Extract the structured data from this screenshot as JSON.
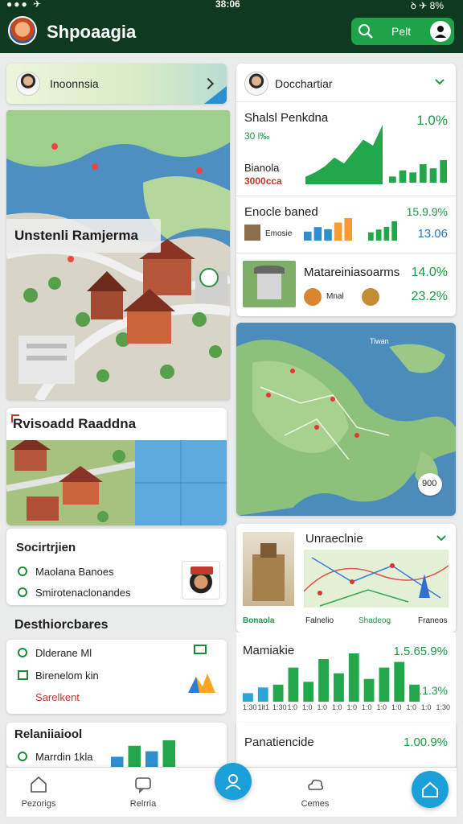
{
  "status_bar": {
    "time": "38:06",
    "signal": "●●● ✈",
    "battery": "ꝺ ✈ 8%"
  },
  "app": {
    "title": "Shpoaagia"
  },
  "header": {
    "search_label": "Pelt"
  },
  "colors": {
    "brand_dark": "#0f3a1f",
    "accent_green": "#1fa34a",
    "fab_blue": "#1b9fd8"
  },
  "left": {
    "region_card": {
      "title": "Inoonnsia"
    },
    "map_overlay_label": "Unstenli Ramjerma",
    "heritage_title": "Rvisoadd Raaddna",
    "social": {
      "title": "Socirtrjien",
      "items": [
        "Maolana Banoes",
        "Smirotenaclonandes"
      ]
    },
    "destinations": {
      "heading": "Desthiorcbares",
      "items": [
        "Dlderane Ml",
        "Birenelom kin",
        "Sarelkent"
      ]
    },
    "relations": {
      "heading": "Relaniiaiool",
      "items": [
        "Marrdin 1kla"
      ]
    }
  },
  "right": {
    "kpi_header": {
      "title": "Docchartiar"
    },
    "kpi_rows": [
      {
        "title": "Shalsl Penkdna",
        "subtitle": "30 l‰",
        "sub2": "Bianola",
        "sub3": "3000cca",
        "value": "1.0%"
      },
      {
        "title": "Enocle baned",
        "sub": "Emosie",
        "value1": "15.9.9%",
        "value2": "13.06"
      },
      {
        "title": "Matareiniasoarms",
        "sub": "Mnal",
        "value1": "14.0%",
        "value2": "23.2%"
      }
    ],
    "map_badge": "900",
    "map_label": "Tiwan",
    "route_card": {
      "title": "Unraeclnie",
      "tabs": [
        "Bonaola",
        "Falnelio",
        "Shadeog",
        "Franeos"
      ]
    },
    "stats": {
      "title": "Mamiakie",
      "value1": "1.5.65.9%",
      "value2": "1.1.3%",
      "tick_labels": [
        "1:30",
        "1lt1",
        "1:30",
        "1:0",
        "1:0",
        "1:0",
        "1:0",
        "1:0",
        "1:0",
        "1:0",
        "1:0",
        "1:0",
        "1:0",
        "1:30"
      ]
    },
    "performance": {
      "title": "Panatiencide",
      "value": "1.00.9%"
    }
  },
  "chart_data": [
    {
      "type": "area",
      "series": [
        {
          "values": [
            5,
            8,
            12,
            18,
            14,
            22,
            30,
            26,
            40
          ]
        }
      ]
    },
    {
      "type": "bar",
      "series": [
        {
          "values": [
            3,
            6,
            5,
            9,
            7,
            11
          ]
        }
      ]
    },
    {
      "type": "bar",
      "series": [
        {
          "values": [
            4,
            6,
            5,
            8,
            10
          ]
        }
      ]
    },
    {
      "type": "bar",
      "series": [
        {
          "values": [
            6,
            8,
            10,
            14
          ]
        }
      ]
    },
    {
      "type": "bar",
      "series": [
        {
          "values": [
            3,
            5,
            6,
            12,
            7,
            15,
            10,
            17,
            8,
            12,
            14,
            6
          ]
        }
      ]
    }
  ],
  "bottom_nav": {
    "items": [
      {
        "label": "Pezorigs",
        "icon": "home-icon"
      },
      {
        "label": "Relrria",
        "icon": "chat-icon"
      },
      {
        "label": "",
        "icon": "profile-icon"
      },
      {
        "label": "Cemes",
        "icon": "cloud-icon"
      },
      {
        "label": "",
        "icon": "home-alt-icon"
      }
    ]
  }
}
